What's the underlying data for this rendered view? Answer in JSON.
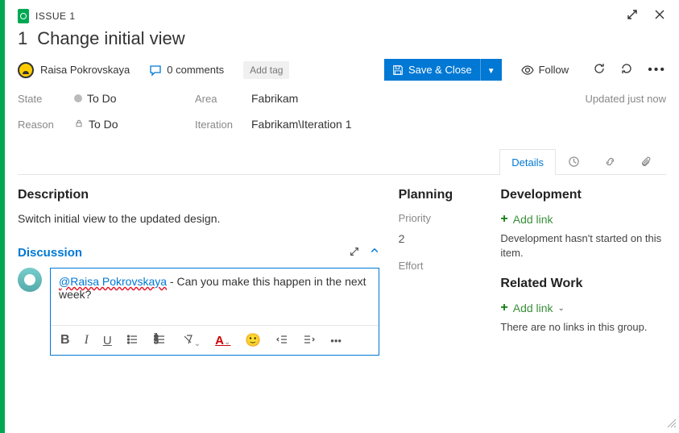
{
  "header": {
    "issue_label": "ISSUE 1",
    "id": "1",
    "title": "Change initial view"
  },
  "assignee": {
    "name": "Raisa Pokrovskaya"
  },
  "actions": {
    "comments_label": "0 comments",
    "add_tag": "Add tag",
    "save_close": "Save & Close",
    "follow": "Follow"
  },
  "fields": {
    "state_label": "State",
    "state_value": "To Do",
    "reason_label": "Reason",
    "reason_value": "To Do",
    "area_label": "Area",
    "area_value": "Fabrikam",
    "iteration_label": "Iteration",
    "iteration_value": "Fabrikam\\Iteration 1",
    "updated": "Updated just now"
  },
  "tabs": {
    "details": "Details"
  },
  "description": {
    "heading": "Description",
    "text": "Switch initial view to the updated design."
  },
  "discussion": {
    "heading": "Discussion",
    "mention": "@Raisa Pokrovskaya",
    "body_rest": " - Can you make this happen in the next week?"
  },
  "planning": {
    "heading": "Planning",
    "priority_label": "Priority",
    "priority_value": "2",
    "effort_label": "Effort"
  },
  "development": {
    "heading": "Development",
    "addlink": "Add link",
    "text": "Development hasn't started on this item."
  },
  "related": {
    "heading": "Related Work",
    "addlink": "Add link",
    "text": "There are no links in this group."
  }
}
